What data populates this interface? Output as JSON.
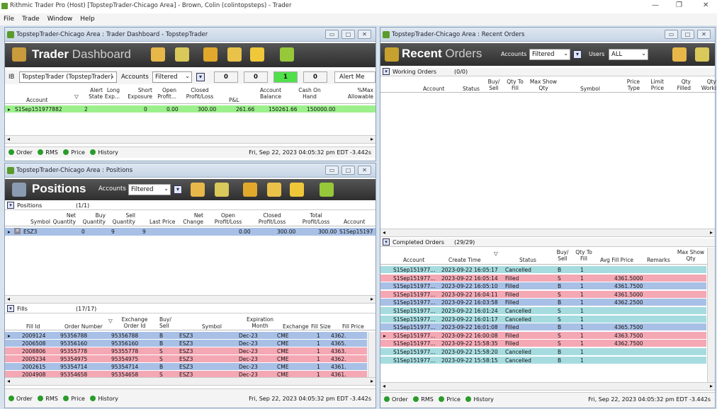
{
  "app": {
    "title": "Rithmic Trader Pro (Host) [TopstepTrader-Chicago Area] - Brown, Colin (colintopsteps) - Trader",
    "menu": [
      "File",
      "Trade",
      "Window",
      "Help"
    ]
  },
  "dashboard": {
    "window_title": "TopstepTrader-Chicago Area : Trader Dashboard - TopstepTrader",
    "banner_bold": "Trader",
    "banner_light": "Dashboard",
    "ib_label": "IB",
    "ib_value": "TopstepTrader (TopstepTrader)",
    "accounts_label": "Accounts",
    "accounts_value": "Filtered",
    "counts": [
      "0",
      "0",
      "1",
      "0"
    ],
    "alert_button": "Alert Me",
    "headers": [
      "Account",
      "Alert State",
      "Long Exp...",
      "Short Exposure",
      "Open Profit...",
      "Closed Profit/Loss",
      "P&L",
      "Account Balance",
      "Cash On Hand",
      "%Max Allowable"
    ],
    "row": [
      "S1Sep151977882",
      "2",
      "",
      "0",
      "0.00",
      "300.00",
      "261.66",
      "150261.66",
      "150000.00",
      ""
    ],
    "status_items": [
      "Order",
      "RMS",
      "Price",
      "History"
    ],
    "timestamp": "Fri, Sep 22, 2023 04:05:32 pm EDT -3.442s"
  },
  "positions": {
    "window_title": "TopstepTrader-Chicago Area : Positions",
    "banner": "Positions",
    "accounts_label": "Accounts",
    "accounts_value": "Filtered",
    "section_label": "Positions",
    "section_count": "(1/1)",
    "headers": [
      "Symbol",
      "Net Quantity",
      "Buy Quantity",
      "Sell Quantity",
      "Last Price",
      "Net Change",
      "Open Profit/Loss",
      "Closed Profit/Loss",
      "Total Profit/Loss",
      "Account"
    ],
    "row": [
      "ESZ3",
      "0",
      "9",
      "9",
      "",
      "",
      "0.00",
      "300.00",
      "300.00",
      "S1Sep15197"
    ],
    "fills_label": "Fills",
    "fills_count": "(17/17)",
    "fills_headers": [
      "Fill Id",
      "Order Number",
      "Exchange Order Id",
      "Buy/ Sell",
      "Symbol",
      "Expiration Month",
      "Exchange",
      "Fill Size",
      "Fill Price"
    ],
    "fills": [
      [
        "2009124",
        "95356788",
        "95356788",
        "B",
        "ESZ3",
        "Dec-23",
        "CME",
        "1",
        "4362."
      ],
      [
        "2006508",
        "95356160",
        "95356160",
        "B",
        "ESZ3",
        "Dec-23",
        "CME",
        "1",
        "4365."
      ],
      [
        "2008806",
        "95355778",
        "95355778",
        "S",
        "ESZ3",
        "Dec-23",
        "CME",
        "1",
        "4363."
      ],
      [
        "2005234",
        "95354975",
        "95354975",
        "S",
        "ESZ3",
        "Dec-23",
        "CME",
        "1",
        "4362."
      ],
      [
        "2002615",
        "95354714",
        "95354714",
        "B",
        "ESZ3",
        "Dec-23",
        "CME",
        "1",
        "4361."
      ],
      [
        "2004908",
        "95354658",
        "95354658",
        "S",
        "ESZ3",
        "Dec-23",
        "CME",
        "1",
        "4361."
      ]
    ],
    "status_items": [
      "Order",
      "RMS",
      "Price",
      "History"
    ],
    "timestamp": "Fri, Sep 22, 2023 04:05:32 pm EDT -3.442s"
  },
  "orders": {
    "window_title": "TopstepTrader-Chicago Area : Recent Orders",
    "banner_bold": "Recent",
    "banner_light": "Orders",
    "accounts_label": "Accounts",
    "accounts_value": "Filtered",
    "users_label": "Users",
    "users_value": "ALL",
    "working_label": "Working Orders",
    "working_count": "(0/0)",
    "working_headers": [
      "Account",
      "Status",
      "Buy/ Sell",
      "Qty To Fill",
      "Max Show Qty",
      "Symbol",
      "Price Type",
      "Limit Price",
      "Qty Filled",
      "Qty Worki"
    ],
    "completed_label": "Completed Orders",
    "completed_count": "(29/29)",
    "completed_headers": [
      "Account",
      "Create Time",
      "Status",
      "Buy/ Sell",
      "Qty To Fill",
      "Avg Fill Price",
      "Remarks",
      "Max Show Qty"
    ],
    "completed": [
      [
        "S1Sep151977...",
        "2023-09-22 16:05:17",
        "Cancelled",
        "B",
        "1",
        ""
      ],
      [
        "S1Sep151977...",
        "2023-09-22 16:05:14",
        "Filled",
        "S",
        "1",
        "4361.5000"
      ],
      [
        "S1Sep151977...",
        "2023-09-22 16:05:10",
        "Filled",
        "B",
        "1",
        "4361.7500"
      ],
      [
        "S1Sep151977...",
        "2023-09-22 16:04:11",
        "Filled",
        "S",
        "1",
        "4361.5000"
      ],
      [
        "S1Sep151977...",
        "2023-09-22 16:03:58",
        "Filled",
        "B",
        "1",
        "4362.2500"
      ],
      [
        "S1Sep151977...",
        "2023-09-22 16:01:24",
        "Cancelled",
        "S",
        "1",
        ""
      ],
      [
        "S1Sep151977...",
        "2023-09-22 16:01:17",
        "Cancelled",
        "S",
        "1",
        ""
      ],
      [
        "S1Sep151977...",
        "2023-09-22 16:01:08",
        "Filled",
        "B",
        "1",
        "4365.7500"
      ],
      [
        "S1Sep151977...",
        "2023-09-22 16:00:08",
        "Filled",
        "S",
        "1",
        "4363.7500"
      ],
      [
        "S1Sep151977...",
        "2023-09-22 15:58:35",
        "Filled",
        "S",
        "1",
        "4362.7500"
      ],
      [
        "S1Sep151977...",
        "2023-09-22 15:58:20",
        "Cancelled",
        "B",
        "1",
        ""
      ],
      [
        "S1Sep151977...",
        "2023-09-22 15:58:15",
        "Cancelled",
        "B",
        "1",
        ""
      ]
    ],
    "status_items": [
      "Order",
      "RMS",
      "Price",
      "History"
    ],
    "timestamp": "Fri, Sep 22, 2023 04:05:32 pm EDT -3.442s"
  }
}
